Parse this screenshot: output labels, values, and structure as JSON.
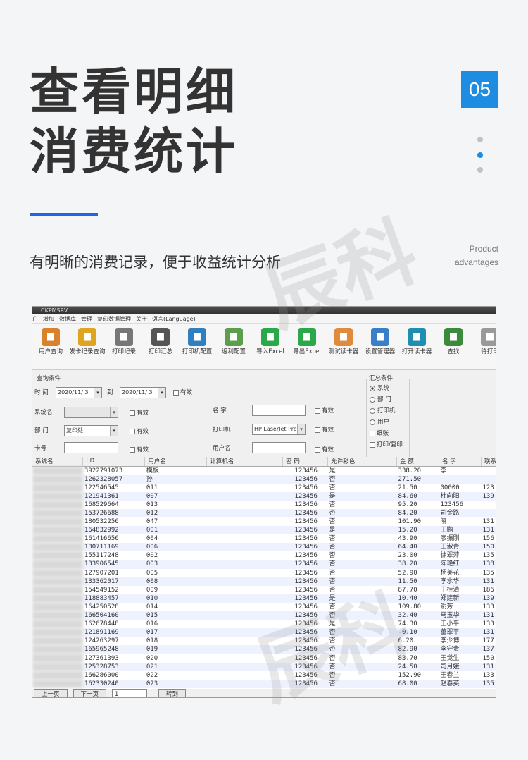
{
  "heading": {
    "line1": "查看明细",
    "line2": "消费统计"
  },
  "badge": "05",
  "subtitle": "有明晰的消费记录，便于收益统计分析",
  "product_label": {
    "line1": "Product",
    "line2": "advantages"
  },
  "watermark": "辰科",
  "app": {
    "title": "CKPMSRV",
    "menu": [
      "户",
      "增加",
      "数据库",
      "管理",
      "复印数据管理",
      "关于",
      "语言(Language)"
    ],
    "toolbar": [
      {
        "label": "用户查询",
        "icon": "users-icon",
        "color": "#d9822b"
      },
      {
        "label": "发卡记录查询",
        "icon": "card-record-icon",
        "color": "#e0a520"
      },
      {
        "label": "打印记录",
        "icon": "printer-icon",
        "color": "#777777"
      },
      {
        "label": "打印汇总",
        "icon": "print-summary-icon",
        "color": "#555555"
      },
      {
        "label": "打印机配置",
        "icon": "printer-config-icon",
        "color": "#2f7fc1"
      },
      {
        "label": "返利配置",
        "icon": "rebate-config-icon",
        "color": "#5d9e4a"
      },
      {
        "label": "导入Excel",
        "icon": "import-excel-icon",
        "color": "#2aa84a"
      },
      {
        "label": "导出Excel",
        "icon": "export-excel-icon",
        "color": "#2aa84a"
      },
      {
        "label": "测试读卡器",
        "icon": "test-reader-icon",
        "color": "#e08a3c"
      },
      {
        "label": "设置管理器",
        "icon": "settings-manager-icon",
        "color": "#3a7dc9"
      },
      {
        "label": "打开读卡器",
        "icon": "open-reader-icon",
        "color": "#1e8fb0"
      },
      {
        "label": "查找",
        "icon": "search-icon",
        "color": "#3c8a3c"
      },
      {
        "label": "待打印",
        "icon": "pending-print-icon",
        "color": "#999999"
      }
    ],
    "query": {
      "group_label": "查询条件",
      "time_label": "时 间",
      "date_from": "2020/11/ 3",
      "to_label": "到",
      "date_to": "2020/11/ 3",
      "valid_label": "有效",
      "system_name_label": "系统名",
      "dept_label": "部 门",
      "dept_value": "复印处",
      "card_label": "卡号",
      "name_label": "名 字",
      "printer_label": "打印机",
      "printer_value": "HP LaserJet Prc",
      "username_label": "用户名"
    },
    "summary": {
      "label": "汇总条件",
      "radios": [
        "系统",
        "部 门",
        "打印机",
        "用户"
      ],
      "checks": [
        "纸张",
        "打印/复印"
      ]
    },
    "table": {
      "columns": [
        "系统名",
        "I  D",
        "用户名",
        "计算机名",
        "密 码",
        "允许彩色",
        "金 额",
        "名 字",
        "联系"
      ],
      "rows": [
        [
          "3922791073",
          "模板",
          "123456",
          "是",
          "338.20",
          "李",
          ""
        ],
        [
          "1262328057",
          "孙",
          "123456",
          "否",
          "271.50",
          "",
          ""
        ],
        [
          "122546545",
          "011",
          "123456",
          "否",
          "21.50",
          "00000",
          "123"
        ],
        [
          "121941361",
          "007",
          "123456",
          "是",
          "84.60",
          "杜向阳",
          "139"
        ],
        [
          "168529664",
          "013",
          "123456",
          "否",
          "95.20",
          "123456",
          ""
        ],
        [
          "153726688",
          "012",
          "123456",
          "否",
          "84.20",
          "司金路",
          ""
        ],
        [
          "180532256",
          "047",
          "123456",
          "否",
          "101.90",
          "晓",
          "131"
        ],
        [
          "164832992",
          "001",
          "123456",
          "是",
          "15.20",
          "王鹏",
          "131"
        ],
        [
          "161416656",
          "004",
          "123456",
          "否",
          "43.90",
          "廖振刚",
          "156"
        ],
        [
          "130711169",
          "006",
          "123456",
          "否",
          "64.40",
          "王淑青",
          "150"
        ],
        [
          "155117248",
          "002",
          "123456",
          "否",
          "23.00",
          "徐翠萍",
          "135"
        ],
        [
          "133906545",
          "003",
          "123456",
          "否",
          "38.20",
          "陈艳红",
          "138"
        ],
        [
          "127907201",
          "005",
          "123456",
          "否",
          "52.90",
          "杨美花",
          "135"
        ],
        [
          "133362017",
          "008",
          "123456",
          "否",
          "11.50",
          "李水华",
          "131"
        ],
        [
          "154549152",
          "009",
          "123456",
          "否",
          "87.70",
          "于桂清",
          "186"
        ],
        [
          "118883457",
          "010",
          "123456",
          "是",
          "10.40",
          "郑建新",
          "139"
        ],
        [
          "164250528",
          "014",
          "123456",
          "否",
          "109.80",
          "谢芳",
          "133"
        ],
        [
          "166504160",
          "015",
          "123456",
          "否",
          "32.40",
          "马玉华",
          "131"
        ],
        [
          "162678448",
          "016",
          "123456",
          "是",
          "74.30",
          "王小平",
          "133"
        ],
        [
          "121891169",
          "017",
          "123456",
          "否",
          "-0.10",
          "董翠平",
          "131"
        ],
        [
          "124263297",
          "018",
          "123456",
          "否",
          "6.20",
          "李少博",
          "177"
        ],
        [
          "165965248",
          "019",
          "123456",
          "否",
          "82.90",
          "李守贵",
          "137"
        ],
        [
          "127361393",
          "020",
          "123456",
          "否",
          "83.70",
          "王觉生",
          "150"
        ],
        [
          "125328753",
          "021",
          "123456",
          "否",
          "24.50",
          "司月娥",
          "131"
        ],
        [
          "166286000",
          "022",
          "123456",
          "否",
          "152.90",
          "王春兰",
          "133"
        ],
        [
          "162330240",
          "023",
          "123456",
          "否",
          "68.00",
          "赵春英",
          "135"
        ]
      ]
    },
    "footer": {
      "prev": "上一页",
      "next": "下一页",
      "page": "1",
      "goto": "转到"
    }
  }
}
